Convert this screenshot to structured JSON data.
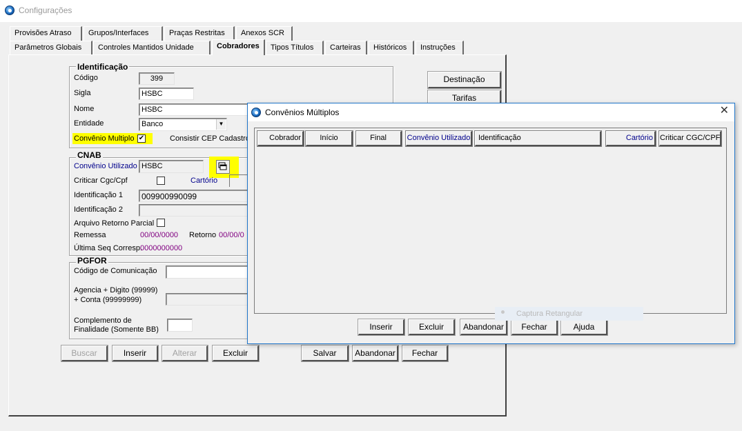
{
  "window": {
    "title": "Configurações"
  },
  "tabs_row1": [
    "Provisões Atraso",
    "Grupos/Interfaces",
    "Praças Restritas",
    "Anexos SCR"
  ],
  "tabs_row2": [
    "Parâmetros Globais",
    "Controles Mantidos Unidade",
    "Cobradores",
    "Tipos Títulos",
    "Carteiras",
    "Históricos",
    "Instruções"
  ],
  "identificacao": {
    "title": "Identificação",
    "codigo_label": "Código",
    "codigo_value": "399",
    "sigla_label": "Sigla",
    "sigla_value": "HSBC",
    "nome_label": "Nome",
    "nome_value": "HSBC",
    "entidade_label": "Entidade",
    "entidade_value": "Banco",
    "convenio_multiplo_label": "Convênio Multiplo",
    "convenio_multiplo_checked": "✔",
    "consistir_cep_label": "Consistir CEP Cadastro"
  },
  "cnab": {
    "title": "CNAB",
    "convenio_utilizado_label": "Convênio Utilizado",
    "convenio_utilizado_value": "HSBC",
    "criticar_label": "Criticar Cgc/Cpf",
    "cartorio_label": "Cartório",
    "ident1_label": "Identificação 1",
    "ident1_value": "009900990099",
    "ident2_label": "Identificação 2",
    "arquivo_retorno_label": "Arquivo Retorno Parcial",
    "remessa_label": "Remessa",
    "remessa_value": "00/00/0000",
    "retorno_label": "Retorno",
    "retorno_value": "00/00/0",
    "ultima_seq_label": "Última Seq Corresp.",
    "ultima_seq_value": "0000000000"
  },
  "pgfor": {
    "title": "PGFOR",
    "codigo_comunicacao_label": "Código de Comunicação",
    "agencia_label_1": "Agencia + Digito (99999)",
    "agencia_label_2": "+ Conta (99999999)",
    "complemento_label_1": "Complemento de",
    "complemento_label_2": "Finalidade (Somente BB)"
  },
  "side_buttons": {
    "destinacao": "Destinação",
    "tarifas": "Tarifas"
  },
  "bottom_buttons": {
    "buscar": "Buscar",
    "inserir": "Inserir",
    "alterar": "Alterar",
    "excluir": "Excluir",
    "salvar": "Salvar",
    "abandonar": "Abandonar",
    "fechar": "Fechar"
  },
  "dialog": {
    "title": "Convênios Múltiplos",
    "columns": [
      "Cobrador",
      "Início",
      "Final",
      "Convênio Utilizado",
      "Identificação",
      "Cartório",
      "Criticar CGC/CPF"
    ],
    "buttons": {
      "inserir": "Inserir",
      "excluir": "Excluir",
      "abandonar": "Abandonar",
      "fechar": "Fechar",
      "ajuda": "Ajuda"
    }
  },
  "overlay": {
    "captura": "Captura Retangular"
  },
  "colors": {
    "highlight": "#ffff00",
    "link_blue": "#00008b",
    "date_purple": "#800080",
    "dialog_border": "#1e74c9"
  }
}
